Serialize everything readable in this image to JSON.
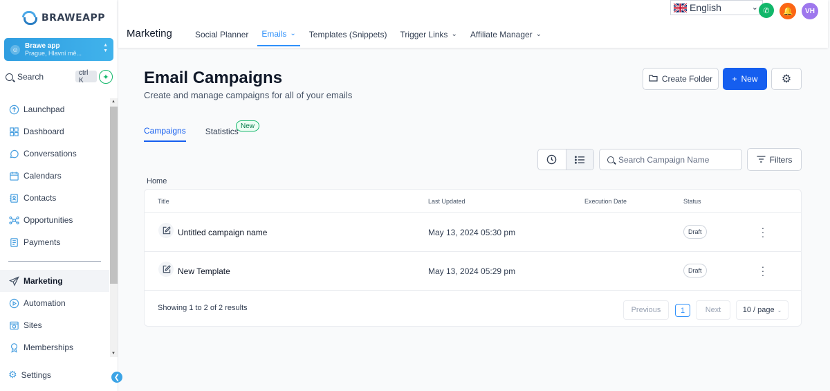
{
  "brand": {
    "name": "BRAWEAPP"
  },
  "account": {
    "name": "Brawe app",
    "location": "Prague, Hlavní mě..."
  },
  "search": {
    "label": "Search",
    "shortcut": "ctrl K"
  },
  "sidebar": {
    "items": [
      {
        "label": "Launchpad"
      },
      {
        "label": "Dashboard"
      },
      {
        "label": "Conversations"
      },
      {
        "label": "Calendars"
      },
      {
        "label": "Contacts"
      },
      {
        "label": "Opportunities"
      },
      {
        "label": "Payments"
      },
      {
        "label": "Marketing"
      },
      {
        "label": "Automation"
      },
      {
        "label": "Sites"
      },
      {
        "label": "Memberships"
      }
    ],
    "settings": "Settings"
  },
  "topbar": {
    "language": "English",
    "user_initials": "VH",
    "module": "Marketing",
    "tabs": [
      {
        "label": "Social Planner"
      },
      {
        "label": "Emails"
      },
      {
        "label": "Templates (Snippets)"
      },
      {
        "label": "Trigger Links"
      },
      {
        "label": "Affiliate Manager"
      }
    ]
  },
  "page": {
    "title": "Email Campaigns",
    "subtitle": "Create and manage campaigns for all of your emails",
    "create_folder": "Create Folder",
    "new_label": "New",
    "subtabs": {
      "campaigns": "Campaigns",
      "statistics": "Statistics",
      "new_badge": "New"
    },
    "search_placeholder": "Search Campaign Name",
    "filters": "Filters",
    "breadcrumb": "Home"
  },
  "table": {
    "columns": {
      "title": "Title",
      "last_updated": "Last Updated",
      "execution_date": "Execution Date",
      "status": "Status"
    },
    "rows": [
      {
        "title": "Untitled campaign name",
        "last_updated": "May 13, 2024 05:30 pm",
        "execution_date": "",
        "status": "Draft"
      },
      {
        "title": "New Template",
        "last_updated": "May 13, 2024 05:29 pm",
        "execution_date": "",
        "status": "Draft"
      }
    ],
    "summary": "Showing 1 to 2 of 2 results",
    "pagination": {
      "previous": "Previous",
      "current": "1",
      "next": "Next",
      "page_size": "10 / page"
    }
  },
  "colors": {
    "primary": "#155eef",
    "accent": "#2e90fa",
    "sidebar_icon": "#4aa0e0",
    "success": "#12b76a",
    "warning": "#fb6514",
    "avatar": "#9e77ed"
  }
}
